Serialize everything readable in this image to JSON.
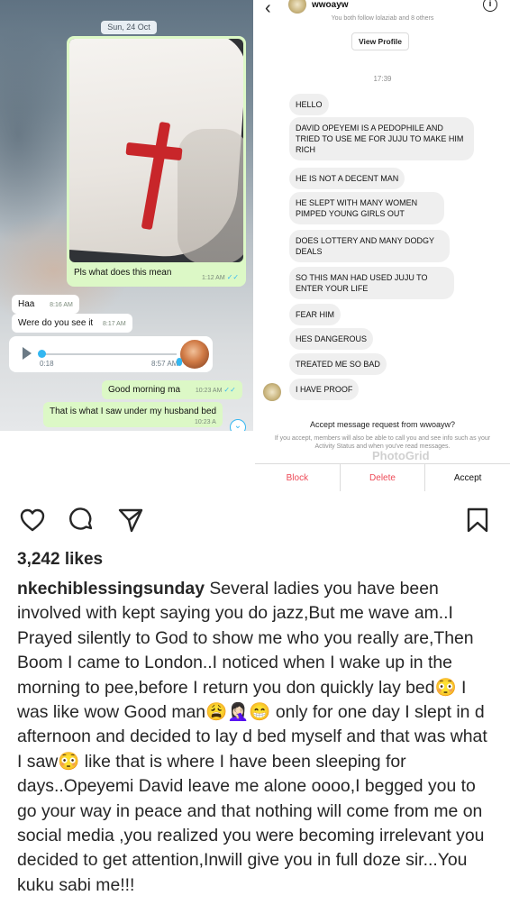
{
  "whatsapp": {
    "date": "Sun, 24 Oct",
    "image_caption": "Pls what does this mean",
    "image_time": "1:12 AM",
    "messages": [
      {
        "dir": "in",
        "text": "Haa",
        "time": "8:16 AM"
      },
      {
        "dir": "in",
        "text": "Were do you see it",
        "time": "8:17 AM"
      },
      {
        "dir": "out",
        "text": "Good morning ma",
        "time": "10:23 AM"
      },
      {
        "dir": "out",
        "text": "That is what I saw under my husband bed",
        "time": "10:23 A"
      }
    ],
    "voice_note": {
      "duration": "0:18",
      "time": "8:57 AM"
    }
  },
  "dm": {
    "username": "wwoayw",
    "follow_info": "You both follow lolaziab and 8 others",
    "view_profile_label": "View Profile",
    "time": "17:39",
    "messages": [
      "HELLO",
      "DAVID OPEYEMI IS A PEDOPHILE AND TRIED TO USE ME FOR JUJU TO MAKE HIM RICH",
      "HE IS NOT A DECENT MAN",
      "HE SLEPT WITH MANY WOMEN PIMPED YOUNG GIRLS OUT",
      "DOES LOTTERY AND MANY DODGY DEALS",
      "SO THIS MAN HAD USED JUJU TO ENTER YOUR LIFE",
      "FEAR HIM",
      "HES DANGEROUS",
      "TREATED ME SO BAD",
      "I HAVE PROOF"
    ],
    "request_title": "Accept message request from wwoayw?",
    "request_subtitle": "If you accept, members will also be able to call you and see info such as your Activity Status and when you've read messages.",
    "watermark": "PhotoGrid",
    "block_label": "Block",
    "delete_label": "Delete",
    "accept_label": "Accept"
  },
  "post": {
    "icons": [
      "heart-icon",
      "comment-icon",
      "share-icon",
      "bookmark-icon"
    ],
    "likes": "3,242 likes",
    "username": "nkechiblessingsunday",
    "caption": "Several ladies you have been involved with kept saying you do jazz,But me wave am..I Prayed silently to God to show me who you really are,Then Boom I came to London..I noticed when I wake up in the morning to pee,before I return you don quickly lay bed😳 I was like wow Good man😩🤦🏻‍♀️😁 only for one day I slept in d afternoon and decided to lay d bed myself and that was what I saw😳 like that is where I have been sleeping for days..Opeyemi David leave me alone oooo,I begged you to go your way in peace and that nothing will come from me on social media ,you realized you were becoming irrelevant you decided to get attention,Inwill give you in full doze sir...You kuku sabi me!!!"
  },
  "colors": {
    "whatsapp_out": "#dcf8c6",
    "ig_red": "#ed4956",
    "tick_blue": "#34b7f1"
  }
}
